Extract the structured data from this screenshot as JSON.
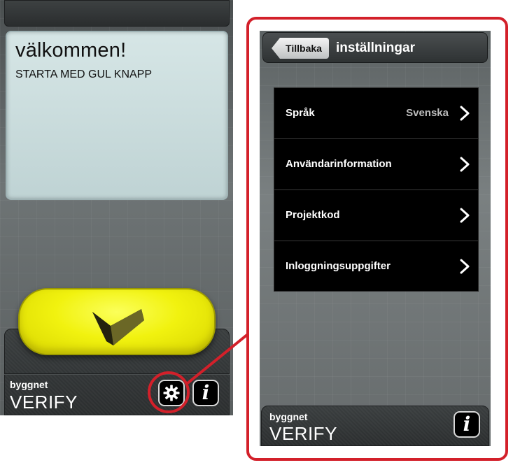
{
  "left_screen": {
    "welcome_title": "välkommen!",
    "welcome_subtitle": "STARTA MED GUL KNAPP",
    "brand_small": "byggnet",
    "brand_big": "VERIFY",
    "info_label": "i",
    "start_button_icon": "checkmark-icon",
    "settings_button_icon": "gear-icon"
  },
  "right_screen": {
    "back_label": "Tillbaka",
    "title": "inställningar",
    "settings": [
      {
        "label": "Språk",
        "value": "Svenska"
      },
      {
        "label": "Användarinformation",
        "value": ""
      },
      {
        "label": "Projektkod",
        "value": ""
      },
      {
        "label": "Inloggningsuppgifter",
        "value": ""
      }
    ],
    "brand_small": "byggnet",
    "brand_big": "VERIFY",
    "info_label": "i"
  },
  "colors": {
    "highlight": "#d3202a",
    "start_button": "#f1f20f"
  }
}
